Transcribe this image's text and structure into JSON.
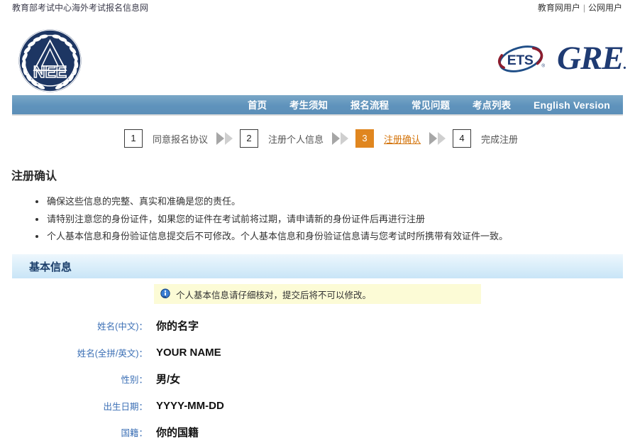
{
  "topbar": {
    "site_name": "教育部考试中心海外考试报名信息网",
    "edu_user_link": "教育网用户",
    "separator": "|",
    "public_user_link": "公网用户"
  },
  "header": {
    "neea_logo_alt": "neea-seal-logo",
    "neea_logo_text": "NEE",
    "ets_logo_text": "ETS",
    "gre_logo_text": "GRE",
    "gre_logo_dot": "."
  },
  "nav": {
    "items": [
      {
        "label": "首页",
        "name": "nav-home"
      },
      {
        "label": "考生须知",
        "name": "nav-test-taker-notice"
      },
      {
        "label": "报名流程",
        "name": "nav-registration-process"
      },
      {
        "label": "常见问题",
        "name": "nav-faq"
      },
      {
        "label": "考点列表",
        "name": "nav-test-center-list"
      },
      {
        "label": "English Version",
        "name": "nav-english-version"
      }
    ]
  },
  "steps": [
    {
      "number": "1",
      "label": "同意报名协议",
      "active": false
    },
    {
      "number": "2",
      "label": "注册个人信息",
      "active": false
    },
    {
      "number": "3",
      "label": "注册确认",
      "active": true
    },
    {
      "number": "4",
      "label": "完成注册",
      "active": false
    }
  ],
  "main": {
    "page_title": "注册确认",
    "notes": [
      "确保这些信息的完整、真实和准确是您的责任。",
      "请特别注意您的身份证件，如果您的证件在考试前将过期，请申请新的身份证件后再进行注册",
      "个人基本信息和身份验证信息提交后不可修改。个人基本信息和身份验证信息请与您考试时所携带有效证件一致。"
    ],
    "section_title": "基本信息",
    "notice_text": "个人基本信息请仔细核对，提交后将不可以修改。",
    "fields": [
      {
        "label": "姓名(中文)：",
        "value": "你的名字",
        "name": "field-name-chinese"
      },
      {
        "label": "姓名(全拼/英文)：",
        "value": "YOUR NAME",
        "name": "field-name-english"
      },
      {
        "label": "性别：",
        "value": "男/女",
        "name": "field-gender"
      },
      {
        "label": "出生日期：",
        "value": "YYYY-MM-DD",
        "name": "field-birthdate"
      },
      {
        "label": "国籍：",
        "value": "你的国籍",
        "name": "field-nationality"
      }
    ]
  },
  "colors": {
    "nav_bar": "#5f93bc",
    "step_active": "#e0861f",
    "section_bar": "#dceffa",
    "notice_bg": "#fcfbd6",
    "label_blue": "#3b6fb5",
    "gre_navy": "#1f3b73"
  }
}
